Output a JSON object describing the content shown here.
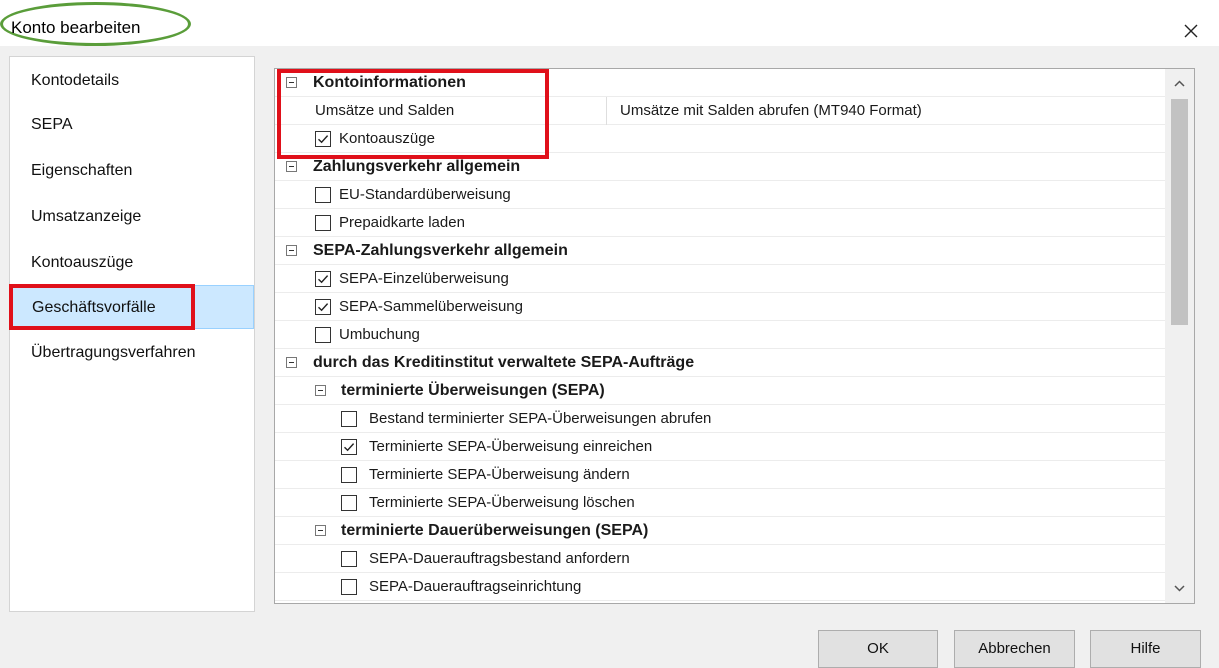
{
  "dialog": {
    "title": "Konto bearbeiten",
    "close_icon": "close-icon"
  },
  "nav": {
    "items": [
      {
        "label": "Kontodetails"
      },
      {
        "label": "SEPA"
      },
      {
        "label": "Eigenschaften"
      },
      {
        "label": "Umsatzanzeige"
      },
      {
        "label": "Kontoauszüge"
      },
      {
        "label": "Geschäftsvorfälle",
        "selected": true
      },
      {
        "label": "Übertragungsverfahren"
      }
    ]
  },
  "tree": {
    "groups": [
      {
        "label": "Kontoinformationen",
        "rows": [
          {
            "label": "Umsätze und Salden",
            "value": "Umsätze mit Salden abrufen (MT940 Format)"
          },
          {
            "label": "Kontoauszüge",
            "checked": true
          }
        ]
      },
      {
        "label": "Zahlungsverkehr allgemein",
        "rows": [
          {
            "label": "EU-Standardüberweisung",
            "checked": false
          },
          {
            "label": "Prepaidkarte laden",
            "checked": false
          }
        ]
      },
      {
        "label": "SEPA-Zahlungsverkehr allgemein",
        "rows": [
          {
            "label": "SEPA-Einzelüberweisung",
            "checked": true
          },
          {
            "label": "SEPA-Sammelüberweisung",
            "checked": true
          },
          {
            "label": "Umbuchung",
            "checked": false
          }
        ]
      },
      {
        "label": "durch das Kreditinstitut verwaltete SEPA-Aufträge",
        "subgroups": [
          {
            "label": "terminierte Überweisungen (SEPA)",
            "rows": [
              {
                "label": "Bestand terminierter SEPA-Überweisungen abrufen",
                "checked": false
              },
              {
                "label": "Terminierte SEPA-Überweisung einreichen",
                "checked": true
              },
              {
                "label": "Terminierte SEPA-Überweisung ändern",
                "checked": false
              },
              {
                "label": "Terminierte SEPA-Überweisung löschen",
                "checked": false
              }
            ]
          },
          {
            "label": "terminierte Dauerüberweisungen (SEPA)",
            "rows": [
              {
                "label": "SEPA-Dauerauftragsbestand anfordern",
                "checked": false
              },
              {
                "label": "SEPA-Dauerauftragseinrichtung",
                "checked": false
              }
            ]
          }
        ]
      }
    ],
    "scroll_up_icon": "chevron-up-icon",
    "scroll_down_icon": "chevron-down-icon"
  },
  "buttons": {
    "ok": "OK",
    "cancel": "Abbrechen",
    "help": "Hilfe"
  },
  "colors": {
    "highlight_box": "#e0101a",
    "title_oval": "#5a9d3a",
    "selected_bg": "#cce8ff"
  }
}
